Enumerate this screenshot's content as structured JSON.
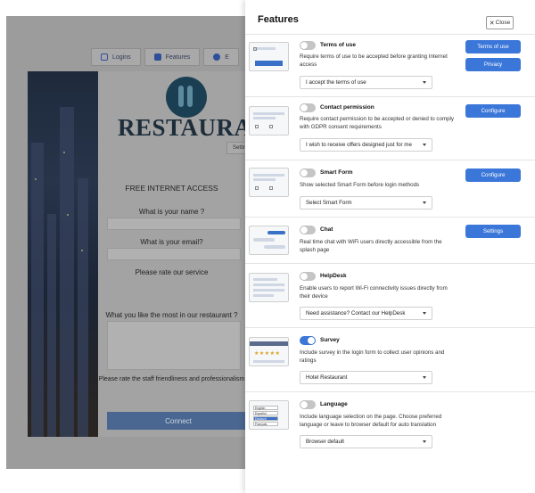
{
  "editor": {
    "tabs": [
      {
        "label": "Logins",
        "icon": "login-icon"
      },
      {
        "label": "Features",
        "icon": "checkbox-icon"
      },
      {
        "label": "E",
        "icon": "circle-icon"
      }
    ],
    "brand": "RESTAURANT",
    "settings_tag": "Settings",
    "form_title": "FREE INTERNET ACCESS",
    "questions": [
      "What is your name ?",
      "What is your email?",
      "Please rate our service",
      "What you like the most in our restaurant ?",
      "Please rate the staff friendliness and professionalism"
    ],
    "connect_label": "Connect"
  },
  "panel": {
    "title": "Features",
    "close_label": "Close",
    "features": [
      {
        "name": "Terms of use",
        "enabled": false,
        "description": "Require terms of use to be accepted before granting Internet access",
        "select_value": "I accept the terms of use",
        "buttons": [
          "Terms of use",
          "Privacy"
        ],
        "thumb_icon": "terms-preview-icon"
      },
      {
        "name": "Contact permission",
        "enabled": false,
        "description": "Require contact permission to be accepted or denied to comply with GDPR consent requirements",
        "select_value": "I wish to receive offers designed just for me",
        "buttons": [
          "Configure"
        ],
        "thumb_icon": "contact-permission-preview-icon"
      },
      {
        "name": "Smart Form",
        "enabled": false,
        "description": "Show selected Smart Form before login methods",
        "select_value": "Select Smart Form",
        "buttons": [
          "Configure"
        ],
        "thumb_icon": "smart-form-preview-icon"
      },
      {
        "name": "Chat",
        "enabled": false,
        "description": "Real time chat with WiFi users directly accessible from the splash page",
        "select_value": null,
        "buttons": [
          "Settings"
        ],
        "thumb_icon": "chat-preview-icon"
      },
      {
        "name": "HelpDesk",
        "enabled": false,
        "description": "Enable users to report Wi-Fi connectivity issues directly from their device",
        "select_value": "Need assistance? Contact our HelpDesk",
        "buttons": [],
        "thumb_icon": "helpdesk-preview-icon"
      },
      {
        "name": "Survey",
        "enabled": true,
        "description": "Include survey in the login form to collect user opinions and ratings",
        "select_value": "Hotel Restaurant",
        "buttons": [],
        "thumb_icon": "survey-preview-icon"
      },
      {
        "name": "Language",
        "enabled": false,
        "description": "Include language selection on the page. Choose preferred language or leave to browser default for auto translation",
        "select_value": "Browser default",
        "buttons": [],
        "thumb_icon": "language-preview-icon"
      }
    ]
  },
  "colors": {
    "accent": "#3b76d9",
    "toggle_off": "#c5c5c5",
    "overlay": "#9c9c9c"
  }
}
